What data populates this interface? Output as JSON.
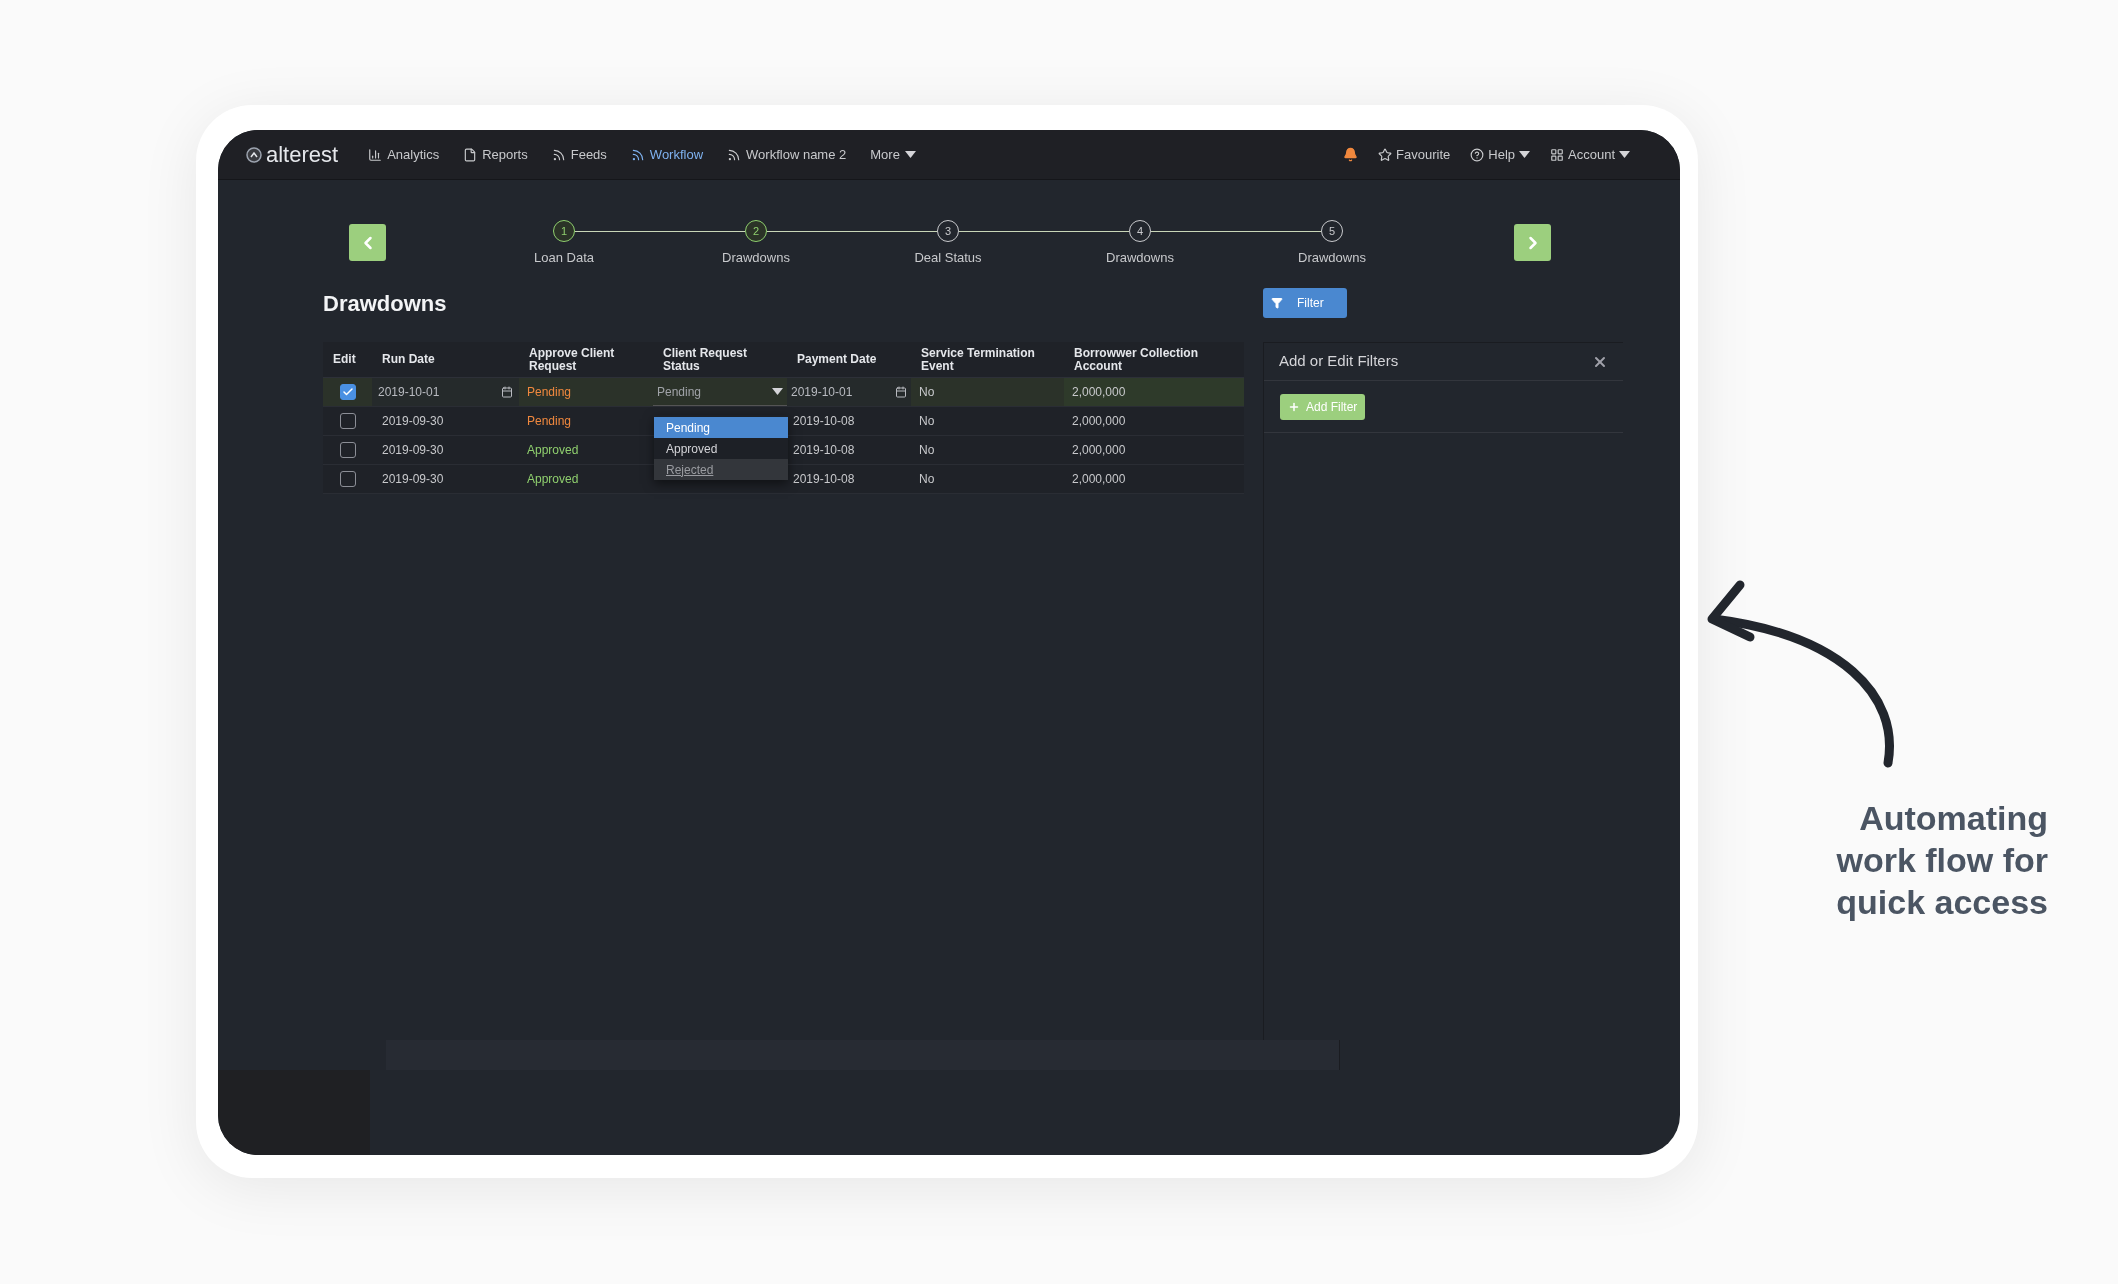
{
  "navbar": {
    "logo": "alterest",
    "items": [
      {
        "label": "Analytics",
        "kind": "chart",
        "selected": false
      },
      {
        "label": "Reports",
        "kind": "file",
        "selected": false
      },
      {
        "label": "Feeds",
        "kind": "rss",
        "selected": false
      },
      {
        "label": "Workflow",
        "kind": "rss",
        "selected": true
      },
      {
        "label": "Workflow name 2",
        "kind": "rss",
        "selected": false
      },
      {
        "label": "More",
        "kind": "caret",
        "selected": false
      }
    ],
    "right_items": [
      {
        "label": "Favourite",
        "kind": "star",
        "caret": false
      },
      {
        "label": "Help",
        "kind": "help",
        "caret": true
      },
      {
        "label": "Account",
        "kind": "grid",
        "caret": true
      }
    ]
  },
  "stepper": {
    "steps": [
      {
        "number": "1",
        "label": "Loan Data",
        "completed": true
      },
      {
        "number": "2",
        "label": "Drawdowns",
        "completed": true
      },
      {
        "number": "3",
        "label": "Deal Status",
        "completed": false
      },
      {
        "number": "4",
        "label": "Drawdowns",
        "completed": false
      },
      {
        "number": "5",
        "label": "Drawdowns",
        "completed": false
      }
    ]
  },
  "page_title": "Drawdowns",
  "filter_button": "Filter",
  "table": {
    "columns": [
      "Edit",
      "Run Date",
      "Approve Client Request",
      "Client Request Status",
      "Payment Date",
      "Service Termination Event",
      "Borrowwer Collection Account"
    ],
    "rows": [
      {
        "checked": true,
        "run_date": "2019-10-01",
        "approve": {
          "text": "Pending",
          "color": "#f0883e"
        },
        "status": "Pending",
        "payment_date": "2019-10-01",
        "termination": "No",
        "account": "2,000,000"
      },
      {
        "checked": false,
        "run_date": "2019-09-30",
        "approve": {
          "text": "Pending",
          "color": "#f0883e"
        },
        "payment_date": "2019-10-08",
        "termination": "No",
        "account": "2,000,000"
      },
      {
        "checked": false,
        "run_date": "2019-09-30",
        "approve": {
          "text": "Approved",
          "color": "#8fcf6e"
        },
        "payment_date": "2019-10-08",
        "termination": "No",
        "account": "2,000,000"
      },
      {
        "checked": false,
        "run_date": "2019-09-30",
        "approve": {
          "text": "Approved",
          "color": "#8fcf6e"
        },
        "payment_date": "2019-10-08",
        "termination": "No",
        "account": "2,000,000"
      }
    ],
    "status_dropdown": {
      "expanded": true,
      "options": [
        {
          "label": "Pending",
          "selected": true,
          "hovered": false
        },
        {
          "label": "Approved",
          "selected": false,
          "hovered": false
        },
        {
          "label": "Rejected",
          "selected": false,
          "hovered": true
        }
      ]
    }
  },
  "filter_panel": {
    "title": "Add or Edit Filters",
    "add_button": "Add Filter"
  },
  "annotation": "Automating work flow for quick access"
}
